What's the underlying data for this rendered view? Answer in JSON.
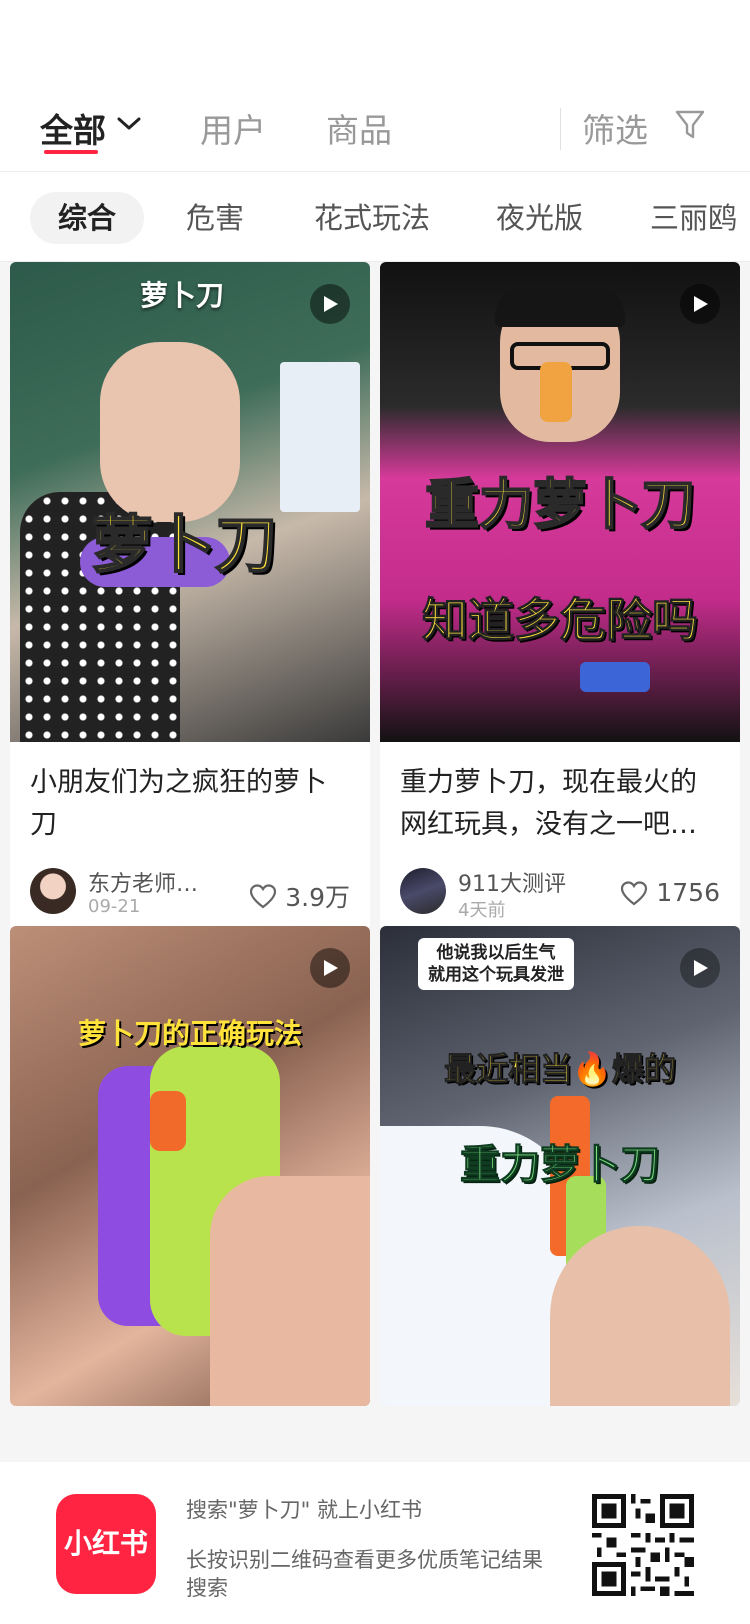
{
  "topbar": {
    "tabs": [
      {
        "label": "全部",
        "active": true
      },
      {
        "label": "用户",
        "active": false
      },
      {
        "label": "商品",
        "active": false
      }
    ],
    "filter_label": "筛选",
    "accent": "#ff2442"
  },
  "chips": [
    {
      "label": "综合",
      "active": true
    },
    {
      "label": "危害",
      "active": false
    },
    {
      "label": "花式玩法",
      "active": false
    },
    {
      "label": "夜光版",
      "active": false
    },
    {
      "label": "三丽鸥",
      "active": false
    }
  ],
  "cards": [
    {
      "overlay_top": "萝卜刀",
      "overlay_main": "萝卜刀",
      "title": "小朋友们为之疯狂的萝卜刀",
      "author": "东方老师…",
      "date": "09-21",
      "likes": "3.9万"
    },
    {
      "overlay_main": "重力萝卜刀",
      "overlay_sub": "知道多危险吗",
      "title": "重力萝卜刀，现在最火的网红玩具，没有之一吧…",
      "author": "911大测评",
      "date": "4天前",
      "likes": "1756"
    },
    {
      "overlay_main": "萝卜刀的正确玩法"
    },
    {
      "overlay_box_line1": "他说我以后生气",
      "overlay_box_line2": "就用这个玩具发泄",
      "overlay_main": "最近相当🔥爆的",
      "overlay_sub": "重力萝卜刀"
    }
  ],
  "banner": {
    "logo_text": "小红书",
    "line1": "搜索\"萝卜刀\" 就上小红书",
    "line2": "长按识别二维码查看更多优质笔记结果搜索"
  }
}
